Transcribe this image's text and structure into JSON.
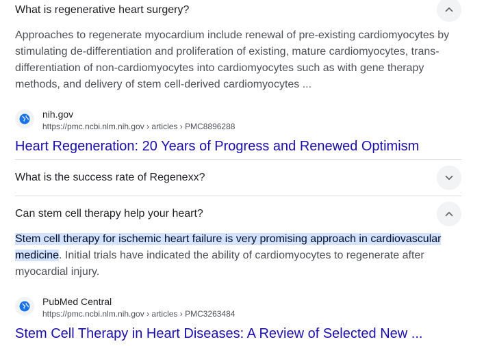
{
  "faq": [
    {
      "question": "What is regenerative heart surgery?",
      "expanded": true,
      "answer_plain": "Approaches to regenerate myocardium include renewal of pre-existing cardiomyocytes by stimulating de-differentiation and proliferation of existing, mature cardiomyocytes, trans-differentiation of non-cardiomyocytes into cardiomyocytes such as with gene therapy methods, and delivery of stem cell-derived cardiomyocytes ...",
      "source_name": "nih.gov",
      "source_url": "https://pmc.ncbi.nlm.nih.gov › articles › PMC8896288",
      "result_title": "Heart Regeneration: 20 Years of Progress and Renewed Optimism"
    },
    {
      "question": "What is the success rate of Regenexx?",
      "expanded": false
    },
    {
      "question": "Can stem cell therapy help your heart?",
      "expanded": true,
      "answer_highlight": "Stem cell therapy for ischemic heart failure is very promising approach in cardiovascular medicine",
      "answer_rest": ". Initial trials have indicated the ability of cardiomyocytes to regenerate after myocardial injury.",
      "source_name": "PubMed Central",
      "source_url": "https://pmc.ncbi.nlm.nih.gov › articles › PMC3263484",
      "result_title": "Stem Cell Therapy in Heart Diseases: A Review of Selected New ..."
    }
  ],
  "icons": {
    "chevron_up": "chevron-up-icon",
    "chevron_down": "chevron-down-icon",
    "favicon": "globe-icon"
  },
  "colors": {
    "link": "#1a0dab",
    "highlight": "#d3e3fd",
    "chevron_bg": "#f1f3f4",
    "divider": "#dadce0"
  }
}
